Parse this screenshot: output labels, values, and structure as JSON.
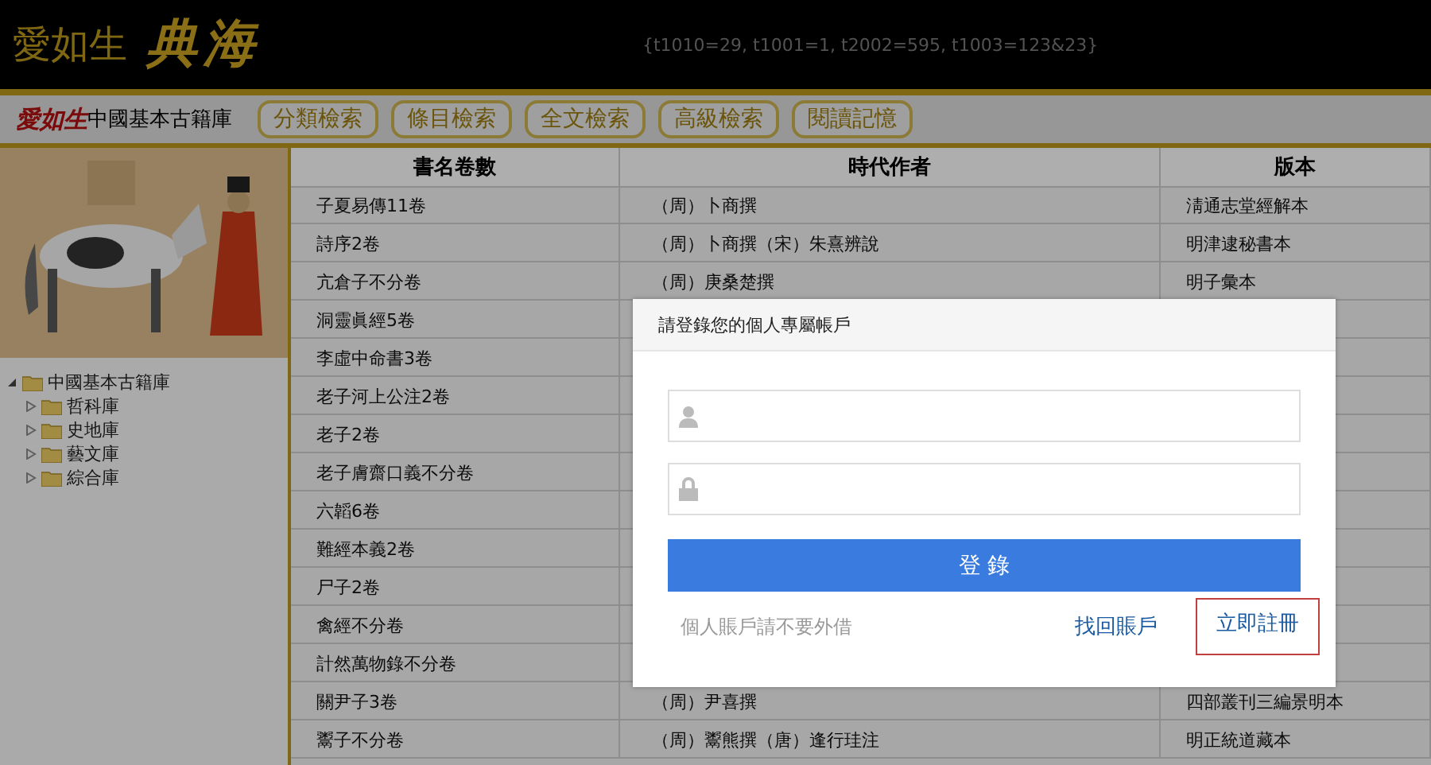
{
  "header": {
    "logo_brand": "愛如生",
    "logo_title": "典海",
    "params": "{t1010=29, t1001=1, t2002=595, t1003=123&23}"
  },
  "nav": {
    "brand": "愛如生",
    "database": "中國基本古籍庫",
    "buttons": [
      "分類檢索",
      "條目檢索",
      "全文檢索",
      "高級檢索",
      "閱讀記憶"
    ]
  },
  "sidebar": {
    "tree": [
      {
        "label": "中國基本古籍庫",
        "expanded": true,
        "children": [
          {
            "label": "哲科庫",
            "expanded": false
          },
          {
            "label": "史地庫",
            "expanded": false
          },
          {
            "label": "藝文庫",
            "expanded": false
          },
          {
            "label": "綜合庫",
            "expanded": false
          }
        ]
      }
    ]
  },
  "table": {
    "columns": [
      "書名卷數",
      "時代作者",
      "版本"
    ],
    "rows": [
      [
        "子夏易傳11卷",
        "（周）卜商撰",
        "淸通志堂經解本"
      ],
      [
        "詩序2卷",
        "（周）卜商撰（宋）朱熹辨說",
        "明津逮秘書本"
      ],
      [
        "亢倉子不分卷",
        "（周）庚桑楚撰",
        "明子彙本"
      ],
      [
        "洞靈眞經5卷",
        "",
        ""
      ],
      [
        "李虛中命書3卷",
        "",
        ""
      ],
      [
        "老子河上公注2卷",
        "",
        ""
      ],
      [
        "老子2卷",
        "",
        ""
      ],
      [
        "老子膚齋口義不分卷",
        "",
        ""
      ],
      [
        "六韜6卷",
        "",
        ""
      ],
      [
        "難經本義2卷",
        "",
        ""
      ],
      [
        "尸子2卷",
        "",
        ""
      ],
      [
        "禽經不分卷",
        "",
        ""
      ],
      [
        "計然萬物錄不分卷",
        "",
        ""
      ],
      [
        "關尹子3卷",
        "（周）尹喜撰",
        "四部叢刊三編景明本"
      ],
      [
        "鬻子不分卷",
        "（周）鬻熊撰（唐）逢行珪注",
        "明正統道藏本"
      ]
    ]
  },
  "login_dialog": {
    "title": "請登錄您的個人專屬帳戶",
    "username": {
      "kind": "user"
    },
    "password": {
      "kind": "lock"
    },
    "submit": "登 錄",
    "note": "個人賬戶請不要外借",
    "recover_link": "找回賬戶",
    "register_link": {
      "label": "立即註冊",
      "highlighted": true
    }
  }
}
